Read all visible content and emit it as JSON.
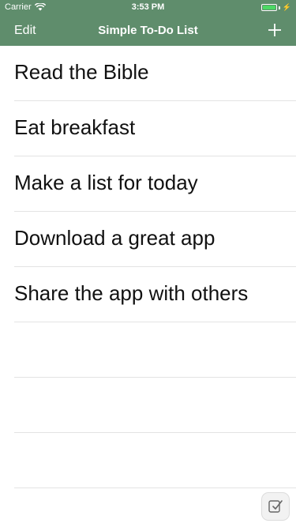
{
  "status_bar": {
    "carrier": "Carrier",
    "time": "3:53 PM"
  },
  "nav": {
    "edit_label": "Edit",
    "title": "Simple To-Do List"
  },
  "colors": {
    "header_bg": "#5f8d6c",
    "battery_fill": "#4cd964"
  },
  "list": {
    "items": [
      "Read the Bible",
      "Eat breakfast",
      "Make a list for today",
      "Download a great app",
      "Share the app with others"
    ]
  },
  "icons": {
    "wifi": "wifi-icon",
    "battery": "battery-icon",
    "add": "plus-icon",
    "badge": "app-badge-icon"
  }
}
